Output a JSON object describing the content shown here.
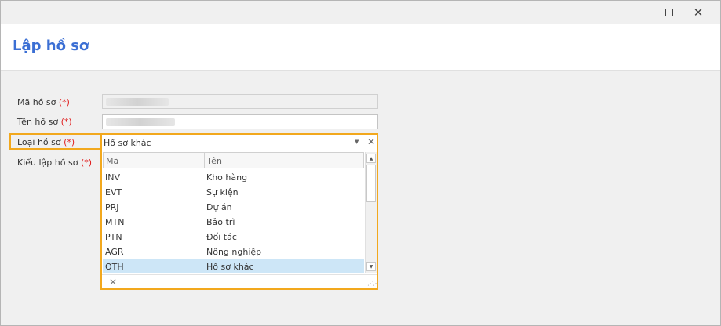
{
  "window": {
    "maximize_icon": "maximize-icon",
    "close_glyph": "✕"
  },
  "header": {
    "title": "Lập hồ sơ"
  },
  "form": {
    "ma_ho_so": {
      "label": "Mã hồ sơ",
      "required": "(*)"
    },
    "ten_ho_so": {
      "label": "Tên hồ sơ",
      "required": "(*)"
    },
    "loai_ho_so": {
      "label": "Loại hồ sơ",
      "required": "(*)",
      "value": "Hồ sơ khác"
    },
    "kieu_lap_ho_so": {
      "label": "Kiểu lập hồ sơ",
      "required": "(*)"
    }
  },
  "dropdown": {
    "columns": [
      "Mã",
      "Tên"
    ],
    "rows": [
      {
        "code": "INV",
        "name": "Kho hàng"
      },
      {
        "code": "EVT",
        "name": "Sự kiện"
      },
      {
        "code": "PRJ",
        "name": "Dự án"
      },
      {
        "code": "MTN",
        "name": "Bảo trì"
      },
      {
        "code": "PTN",
        "name": "Đối tác"
      },
      {
        "code": "AGR",
        "name": "Nông nghiệp"
      },
      {
        "code": "OTH",
        "name": "Hồ sơ khác"
      }
    ],
    "selected_code": "OTH"
  },
  "colors": {
    "accent": "#3b6fd4",
    "highlight": "#f2a81d",
    "required": "#e02020",
    "selected_row": "#cde6f7"
  }
}
